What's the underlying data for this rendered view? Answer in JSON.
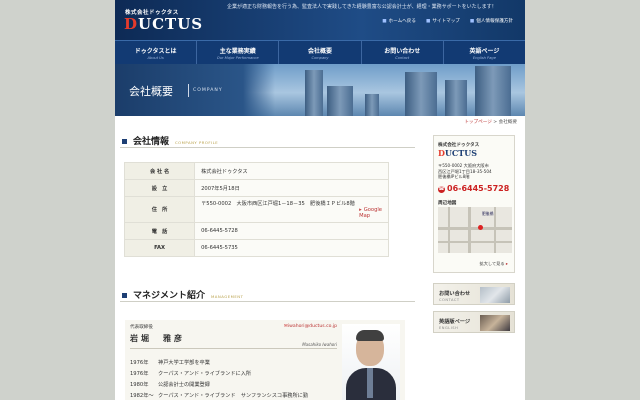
{
  "header": {
    "company_small": "株式会社ドゥクタス",
    "logo_d": "D",
    "logo_rest": "UCTUS",
    "tagline": "企業が適正な財務報告を行う為、監査法人で実践してきた経験豊富な公認会計士が、経理・業務サポートをいたします！",
    "links": [
      "ホームへ戻る",
      "サイトマップ",
      "個人情報保護方針"
    ]
  },
  "nav": [
    {
      "jp": "ドゥクタスとは",
      "en": "About Us"
    },
    {
      "jp": "主な業務実績",
      "en": "Our Major Performance"
    },
    {
      "jp": "会社概要",
      "en": "Company"
    },
    {
      "jp": "お問い合わせ",
      "en": "Contact"
    },
    {
      "jp": "英語ページ",
      "en": "English Page"
    }
  ],
  "hero": {
    "title": "会社概要",
    "en": "COMPANY"
  },
  "breadcrumb": {
    "link": "トップページ",
    "sep": ">",
    "current": "会社概要"
  },
  "profile": {
    "title_jp": "会社情報",
    "title_en": "COMPANY PROFILE",
    "rows": [
      {
        "key": "会 社 名",
        "value": "株式会社ドゥクタス"
      },
      {
        "key": "設　立",
        "value": "2007年5月18日"
      },
      {
        "key": "住　所",
        "value": "〒550-0002　大阪市西区江戸堀1－18－35　肥後橋ＩＰビル8階"
      },
      {
        "key": "電　話",
        "value": "06-6445-5728"
      },
      {
        "key": "FAX",
        "value": "06-6445-5735"
      }
    ],
    "gmap_label": "Google Map"
  },
  "management": {
    "title_jp": "マネジメント紹介",
    "title_en": "MANAGEMENT",
    "role": "代表取締役",
    "email": "iwahori@ductus.co.jp",
    "name": "岩堀　雅彦",
    "romaji": "Masahiko Iwahori",
    "history": [
      {
        "year": "1976年",
        "text": "神戸大学工学部を卒業"
      },
      {
        "year": "1976年",
        "text": "クーパス・アンド・ライブランドに入所"
      },
      {
        "year": "1980年",
        "text": "公認会計士の開業登録"
      },
      {
        "year": "1982年〜",
        "text": "クーパス・アンド・ライブランド　サンフランシスコ事務所に勤"
      }
    ]
  },
  "sidebar": {
    "company_small": "株式会社ドゥクタス",
    "logo_d": "D",
    "logo_rest": "UCTUS",
    "address_lines": [
      "〒550-0002 大阪府大阪市",
      "西区江戸堀1丁目18-35-504",
      "肥後橋IPビル8階"
    ],
    "tel": "06-6445-5728",
    "map_label": "周辺地図",
    "map_station": "肥後橋",
    "more_label": "拡大して見る",
    "contact_jp": "お問い合わせ",
    "contact_en": "CONTACT",
    "english_jp": "英語版ページ",
    "english_en": "ENGLISH"
  }
}
